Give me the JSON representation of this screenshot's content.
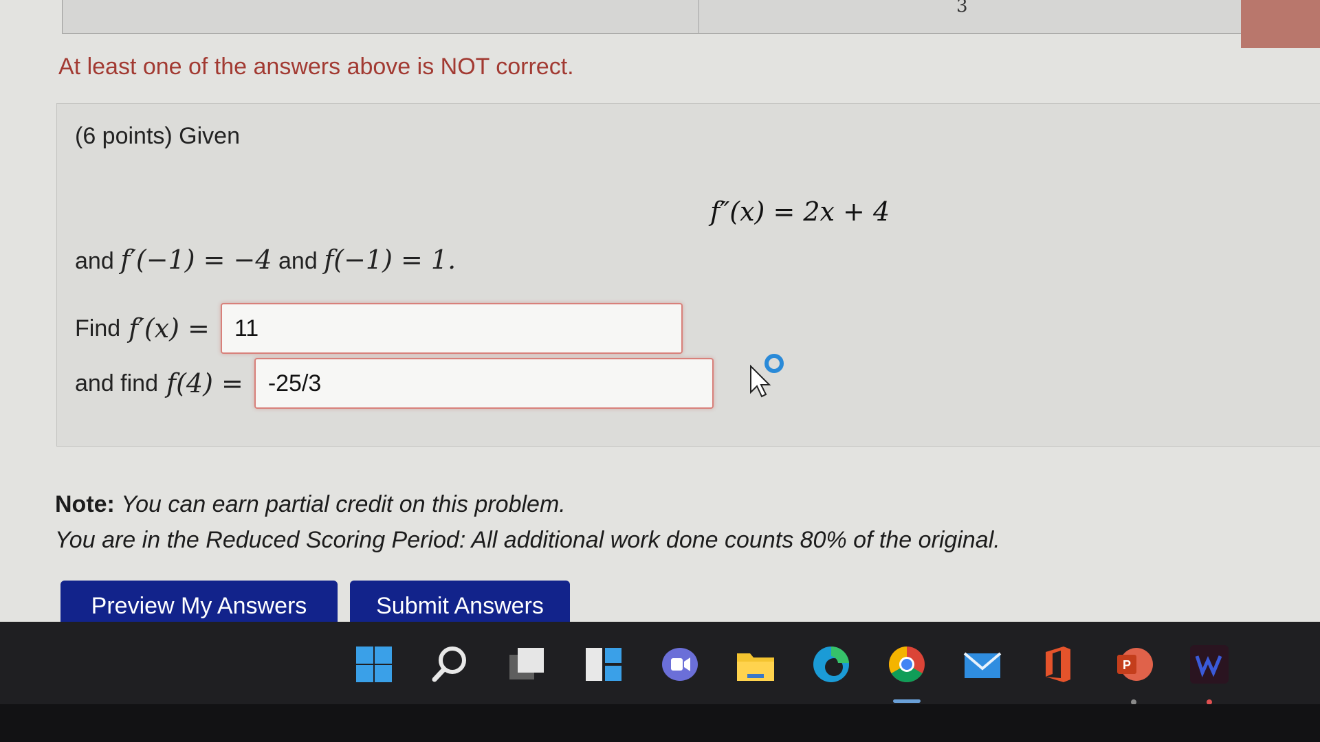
{
  "top_table": {
    "cell_value": "3"
  },
  "status": {
    "error_message": "At least one of the answers above is NOT correct."
  },
  "problem": {
    "intro": "(6 points) Given",
    "formula": {
      "lhs": "f″(x)",
      "eq": "=",
      "rhs": "2x + 4"
    },
    "conditions": {
      "and1": "and",
      "cond1": "f′(−1) = −4",
      "and2": "and",
      "cond2": "f(−1) = 1."
    },
    "q1": {
      "label": "Find",
      "math": "f′(x) =",
      "value": "11"
    },
    "q2": {
      "label": "and find",
      "math": "f(4) =",
      "value": "-25/3"
    }
  },
  "note": {
    "label": "Note:",
    "line1": "You can earn partial credit on this problem.",
    "line2": "You are in the Reduced Scoring Period: All additional work done counts 80% of the original."
  },
  "buttons": {
    "preview": "Preview My Answers",
    "submit": "Submit Answers"
  },
  "taskbar": {
    "icons": [
      "windows-start-icon",
      "search-icon",
      "task-view-icon",
      "widgets-icon",
      "teams-chat-icon",
      "file-explorer-icon",
      "edge-icon",
      "chrome-icon",
      "mail-icon",
      "office-icon",
      "powerpoint-icon",
      "app-icon"
    ],
    "powerpoint_letter": "P"
  },
  "colors": {
    "error": "#a23a32",
    "button": "#12238b",
    "input_border": "#d8807a",
    "taskbar": "#1f1f22"
  }
}
